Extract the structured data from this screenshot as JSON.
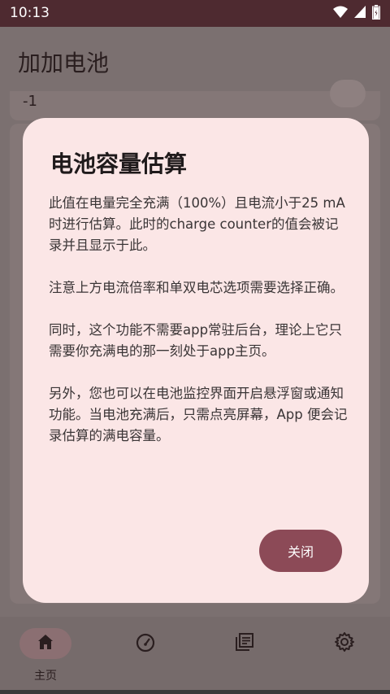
{
  "status_bar": {
    "time": "10:13"
  },
  "app": {
    "title": "加加电池",
    "card_value": "-1"
  },
  "dialog": {
    "title": "电池容量估算",
    "paragraphs": [
      "此值在电量完全充满（100%）且电流小于25 mA 时进行估算。此时的charge counter的值会被记录并且显示于此。",
      "注意上方电流倍率和单双电芯选项需要选择正确。",
      "同时，这个功能不需要app常驻后台，理论上它只需要你充满电的那一刻处于app主页。",
      "另外，您也可以在电池监控界面开启悬浮窗或通知功能。当电池充满后，只需点亮屏幕，App 便会记录估算的满电容量。"
    ],
    "close_label": "关闭"
  },
  "bottom_nav": {
    "items": [
      {
        "label": "主页",
        "icon": "home-icon",
        "active": true
      },
      {
        "label": "",
        "icon": "speedometer-icon",
        "active": false
      },
      {
        "label": "",
        "icon": "library-icon",
        "active": false
      },
      {
        "label": "",
        "icon": "gear-icon",
        "active": false
      }
    ]
  },
  "colors": {
    "accent": "#8c4a57",
    "dialog_bg": "#fbe6e6",
    "status_bar": "#4e2a30"
  }
}
